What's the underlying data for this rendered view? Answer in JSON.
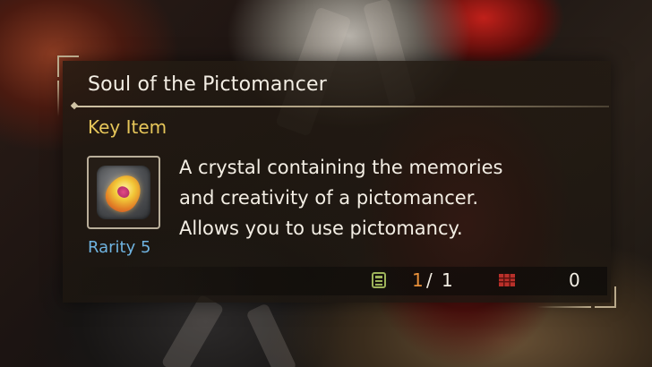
{
  "item": {
    "name": "Soul of the Pictomancer",
    "category": "Key Item",
    "rarity": "Rarity 5",
    "icon": "crystal-icon",
    "description": [
      "A crystal containing the memories",
      "and creativity of a pictomancer.",
      "Allows you to use pictomancy."
    ]
  },
  "stats": {
    "pouch_icon": "pouch-icon",
    "owned": "1",
    "separator": "/",
    "max": "1",
    "box_icon": "item-box-icon",
    "box_count": "0"
  },
  "colors": {
    "category": "#e6c65a",
    "rarity": "#6fb3e0",
    "owned": "#e8903a",
    "text": "#f3eee4",
    "frame": "#b9a98b"
  }
}
